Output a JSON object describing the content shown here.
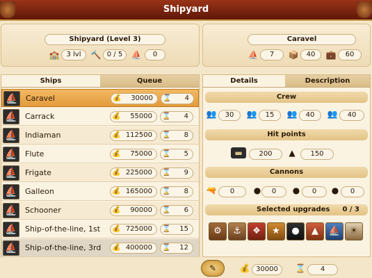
{
  "window": {
    "title": "Shipyard"
  },
  "shipyard_header": {
    "title": "Shipyard (Level 3)",
    "level_value": "3 lvl",
    "workers_value": "0 / 5",
    "docks_value": "0"
  },
  "ship_header": {
    "title": "Caravel",
    "stat1": "7",
    "stat2": "40",
    "stat3": "60"
  },
  "left_tabs": {
    "ships": "Ships",
    "queue": "Queue"
  },
  "ships": [
    {
      "name": "Caravel",
      "gold": "30000",
      "time": "4"
    },
    {
      "name": "Carrack",
      "gold": "55000",
      "time": "4"
    },
    {
      "name": "Indiaman",
      "gold": "112500",
      "time": "8"
    },
    {
      "name": "Flute",
      "gold": "75000",
      "time": "5"
    },
    {
      "name": "Frigate",
      "gold": "225000",
      "time": "9"
    },
    {
      "name": "Galleon",
      "gold": "165000",
      "time": "8"
    },
    {
      "name": "Schooner",
      "gold": "90000",
      "time": "6"
    },
    {
      "name": "Ship-of-the-line, 1st",
      "gold": "725000",
      "time": "15"
    },
    {
      "name": "Ship-of-the-line, 3rd",
      "gold": "400000",
      "time": "12"
    }
  ],
  "right_tabs": {
    "details": "Details",
    "description": "Description"
  },
  "crew": {
    "label": "Crew",
    "values": [
      "30",
      "15",
      "40",
      "40"
    ]
  },
  "hit_points": {
    "label": "Hit points",
    "hull": "200",
    "mast": "150"
  },
  "cannons": {
    "label": "Cannons",
    "values": [
      "0",
      "0",
      "0",
      "0"
    ]
  },
  "upgrades": {
    "label": "Selected upgrades",
    "count": "0 / 3"
  },
  "footer": {
    "gold": "30000",
    "time": "4"
  },
  "colors": {
    "accent": "#e39b3c",
    "title_bar": "#7a2410"
  }
}
